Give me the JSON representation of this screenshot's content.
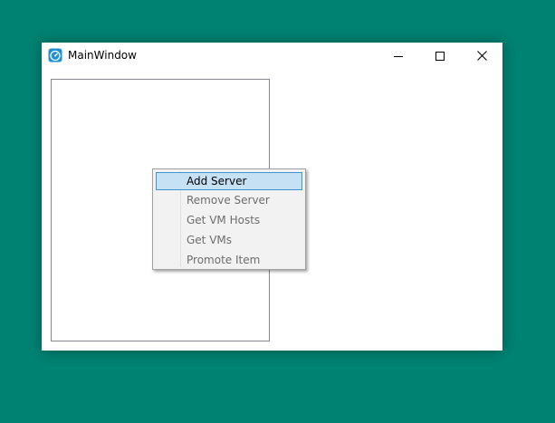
{
  "window": {
    "title": "MainWindow",
    "app_icon": "dashboard-gauge-icon",
    "caption_buttons": {
      "minimize_icon": "minimize-icon",
      "maximize_icon": "maximize-icon",
      "close_icon": "close-icon"
    }
  },
  "context_menu": {
    "items": [
      {
        "label": "Add Server",
        "enabled": true,
        "highlighted": true
      },
      {
        "label": "Remove Server",
        "enabled": false,
        "highlighted": false
      },
      {
        "label": "Get VM Hosts",
        "enabled": false,
        "highlighted": false
      },
      {
        "label": "Get VMs",
        "enabled": false,
        "highlighted": false
      },
      {
        "label": "Promote Item",
        "enabled": false,
        "highlighted": false
      }
    ]
  },
  "colors": {
    "desktop": "#008272",
    "menu_highlight": "#c5e1f3",
    "menu_highlight_border": "#3a95d0",
    "disabled_text": "#6d6d6d",
    "app_icon_accent": "#1e90d8"
  }
}
